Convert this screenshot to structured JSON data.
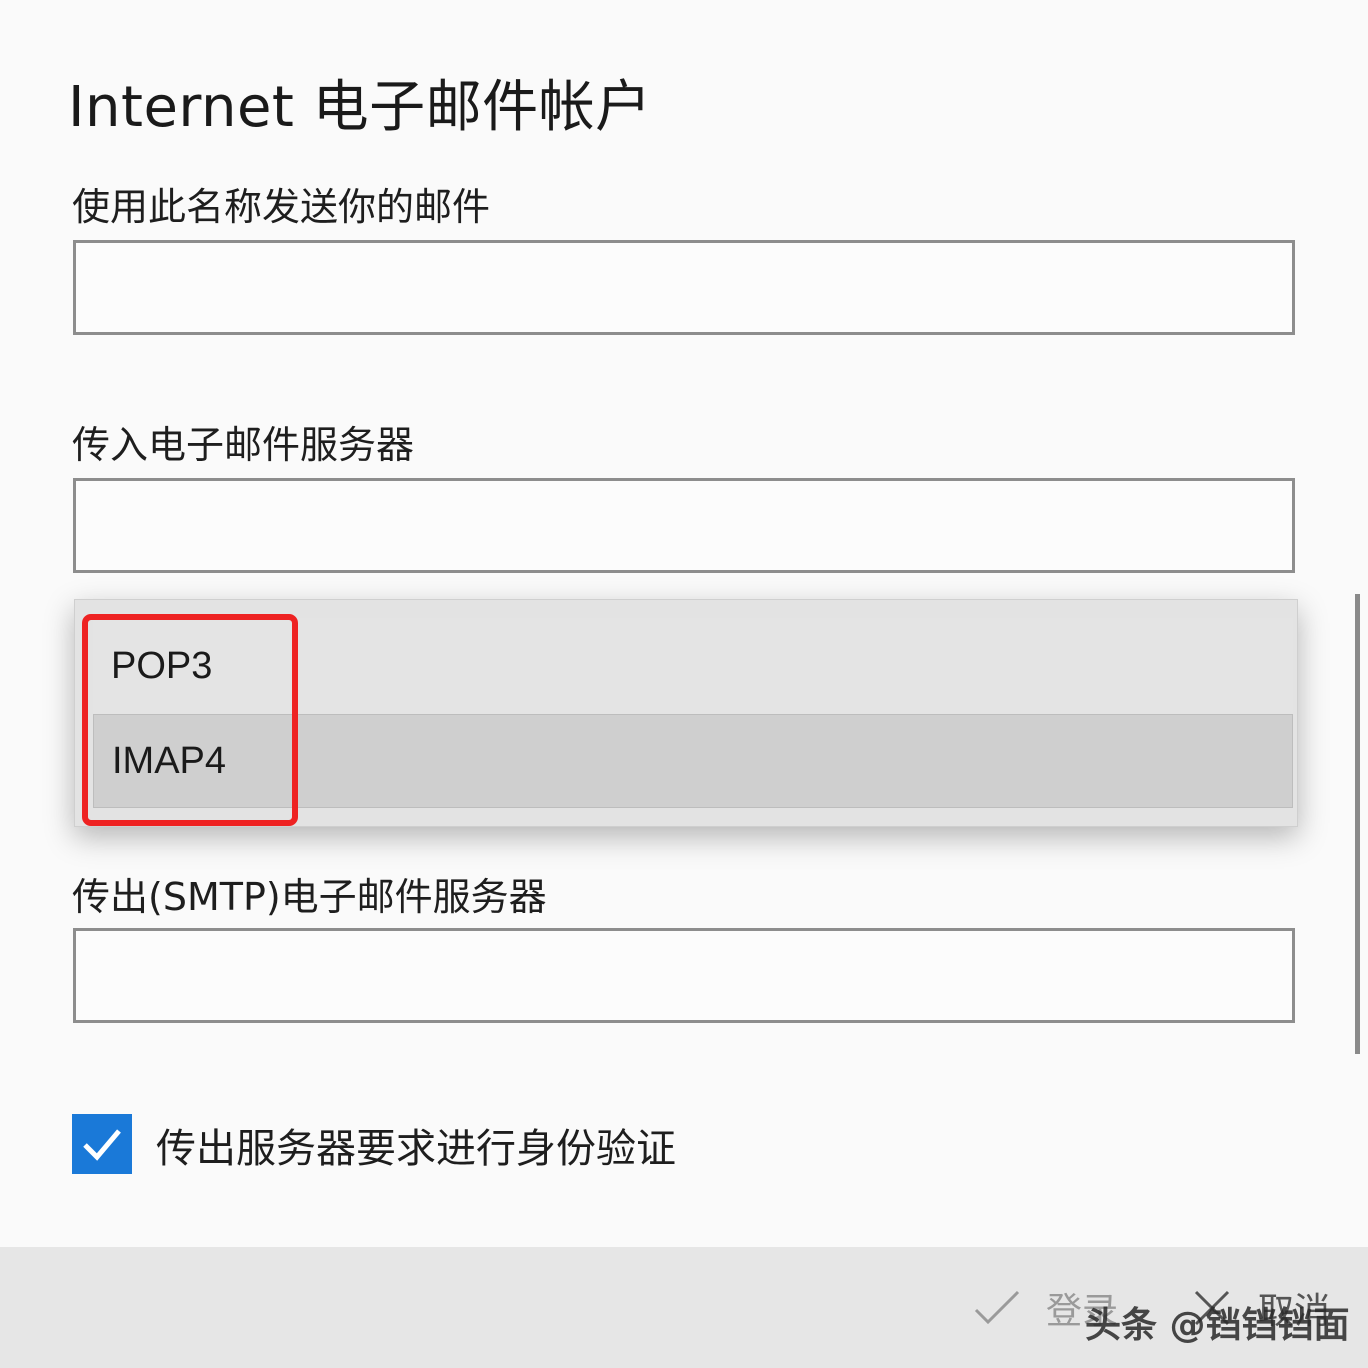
{
  "dialog": {
    "title": "Internet 电子邮件帐户"
  },
  "fields": {
    "sender_name_label": "使用此名称发送你的邮件",
    "sender_name_value": "",
    "incoming_server_label": "传入电子邮件服务器",
    "incoming_server_value": "",
    "outgoing_server_label": "传出(SMTP)电子邮件服务器",
    "outgoing_server_value": ""
  },
  "account_type_dropdown": {
    "options": [
      "POP3",
      "IMAP4"
    ],
    "selected": "IMAP4",
    "annotation_color": "#ee2222"
  },
  "auth_checkbox": {
    "label": "传出服务器要求进行身份验证",
    "checked": true,
    "color": "#1a79d8"
  },
  "footer": {
    "login_label": "登录",
    "cancel_label": "取消"
  },
  "watermark": "头条 @铛铛铛面"
}
